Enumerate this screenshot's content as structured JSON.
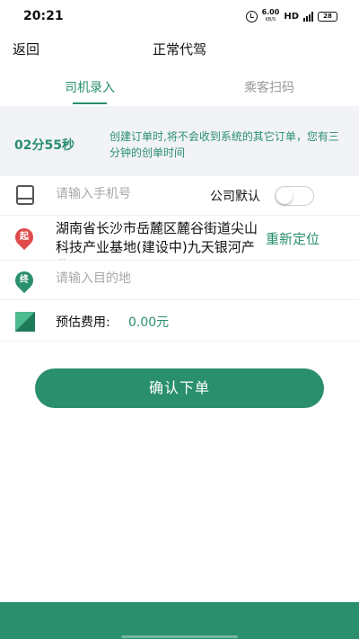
{
  "status_bar": {
    "time": "20:21",
    "net_speed_value": "6.00",
    "net_speed_unit": "KB/S",
    "network_label": "HD",
    "signal_label": "4G",
    "battery": "28"
  },
  "header": {
    "back_label": "返回",
    "title": "正常代驾"
  },
  "tabs": [
    {
      "label": "司机录入",
      "active": true
    },
    {
      "label": "乘客扫码",
      "active": false
    }
  ],
  "notice": {
    "countdown": "02分55秒",
    "message": "创建订单时,将不会收到系统的其它订单，您有三分钟的创单时间"
  },
  "form": {
    "phone_placeholder": "请输入手机号",
    "company_default_label": "公司默认",
    "company_default_on": false,
    "start_marker": "起",
    "start_address": "湖南省长沙市岳麓区麓谷街道尖山科技产业基地(建设中)九天银河产业园",
    "relocate_label": "重新定位",
    "end_marker": "终",
    "destination_placeholder": "请输入目的地",
    "fee_label": "预估费用:",
    "fee_value": "0.00元"
  },
  "confirm_label": "确认下单",
  "colors": {
    "accent": "#2a8f6c",
    "start_marker": "#e04a4a",
    "notice_background": "#f1f3f7"
  }
}
